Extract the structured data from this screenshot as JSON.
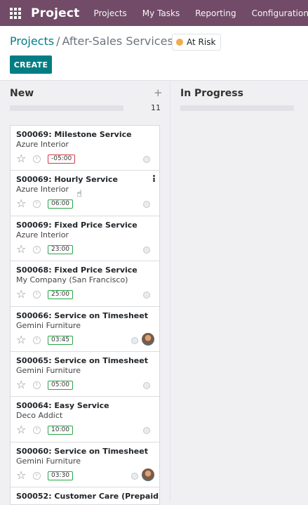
{
  "navbar": {
    "brand": "Project",
    "menu": [
      "Projects",
      "My Tasks",
      "Reporting",
      "Configuration"
    ]
  },
  "breadcrumb": {
    "parent": "Projects",
    "separator": "/",
    "current": "After-Sales Services"
  },
  "status": {
    "label": "At Risk",
    "color": "#f0ad4e"
  },
  "create_label": "CREATE",
  "columns": [
    {
      "title": "New",
      "count": "11"
    },
    {
      "title": "In Progress"
    }
  ],
  "cards": [
    {
      "title": "S00069: Milestone Service",
      "partner": "Azure Interior",
      "time": "-05:00"
    },
    {
      "title": "S00069: Hourly Service",
      "partner": "Azure Interior",
      "time": "06:00"
    },
    {
      "title": "S00069: Fixed Price Service",
      "partner": "Azure Interior",
      "time": "23:00"
    },
    {
      "title": "S00068: Fixed Price Service",
      "partner": "My Company (San Francisco)",
      "time": "25:00"
    },
    {
      "title": "S00066: Service on Timesheet",
      "partner": "Gemini Furniture",
      "time": "03:45"
    },
    {
      "title": "S00065: Service on Timesheet",
      "partner": "Gemini Furniture",
      "time": "05:00"
    },
    {
      "title": "S00064: Easy Service",
      "partner": "Deco Addict",
      "time": "10:00"
    },
    {
      "title": "S00060: Service on Timesheet",
      "partner": "Gemini Furniture",
      "time": "03:30"
    },
    {
      "title": "S00052: Customer Care (Prepaid"
    }
  ],
  "icons": {
    "apps": "apps-grid-icon",
    "add": "plus-icon",
    "star": "star-outline-icon",
    "clock": "clock-icon",
    "kanban_state": "status-circle-icon",
    "menu": "kebab-icon",
    "cursor": "hand-pointer-icon"
  },
  "colors": {
    "navbar": "#714b67",
    "primary": "#017e84",
    "badge_ok": "#28a745",
    "badge_late": "#dc3545"
  }
}
